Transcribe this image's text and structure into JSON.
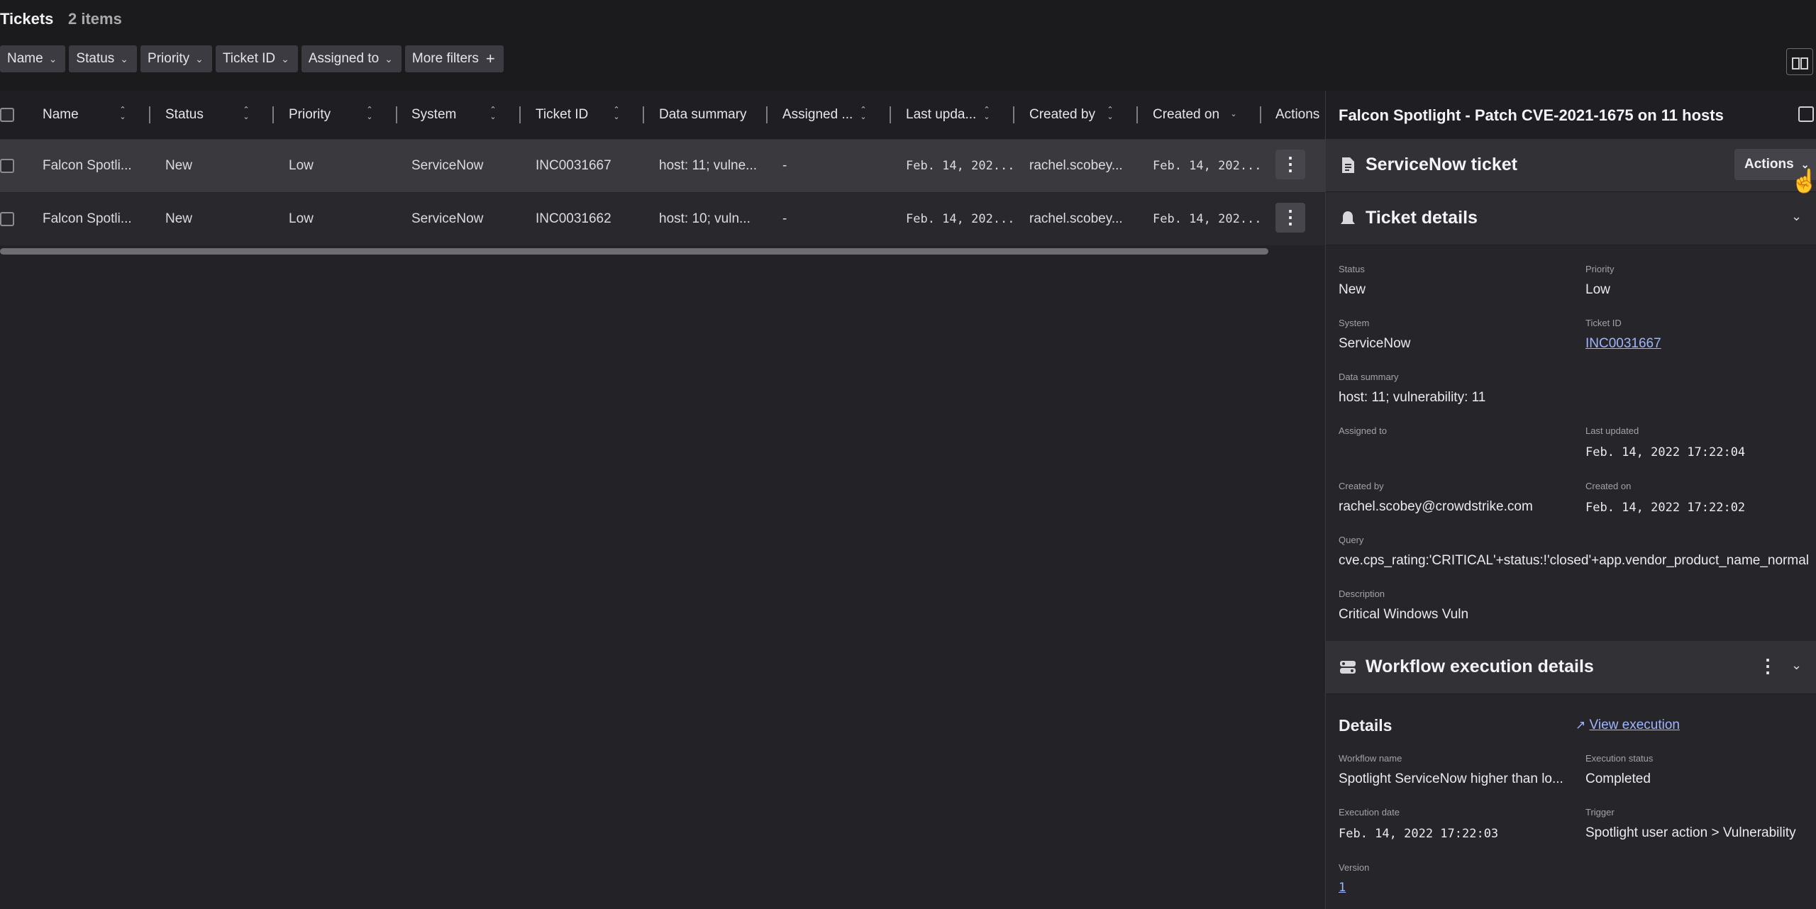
{
  "header": {
    "title": "Tickets",
    "count": "2 items"
  },
  "filters": [
    "Name",
    "Status",
    "Priority",
    "Ticket ID",
    "Assigned to",
    "More filters"
  ],
  "table": {
    "columns": [
      "Name",
      "Status",
      "Priority",
      "System",
      "Ticket ID",
      "Data summary",
      "Assigned ...",
      "Last upda...",
      "Created by",
      "Created on",
      "Actions"
    ],
    "rows": [
      {
        "name": "Falcon Spotli...",
        "status": "New",
        "priority": "Low",
        "system": "ServiceNow",
        "ticket_id": "INC0031667",
        "data_summary": "host: 11; vulne...",
        "assigned": "-",
        "last_updated": "Feb. 14, 202...",
        "created_by": "rachel.scobey...",
        "created_on": "Feb. 14, 202..."
      },
      {
        "name": "Falcon Spotli...",
        "status": "New",
        "priority": "Low",
        "system": "ServiceNow",
        "ticket_id": "INC0031662",
        "data_summary": "host: 10; vuln...",
        "assigned": "-",
        "last_updated": "Feb. 14, 202...",
        "created_by": "rachel.scobey...",
        "created_on": "Feb. 14, 202..."
      }
    ]
  },
  "panel": {
    "title": "Falcon Spotlight - Patch CVE-2021-1675 on 11 hosts",
    "ticket_section": "ServiceNow ticket",
    "actions_label": "Actions",
    "details_section": "Ticket details",
    "fields": {
      "status_label": "Status",
      "status": "New",
      "priority_label": "Priority",
      "priority": "Low",
      "system_label": "System",
      "system": "ServiceNow",
      "ticket_id_label": "Ticket ID",
      "ticket_id": "INC0031667",
      "data_summary_label": "Data summary",
      "data_summary": "host: 11; vulnerability: 11",
      "assigned_label": "Assigned to",
      "last_updated_label": "Last updated",
      "last_updated": "Feb. 14, 2022 17:22:04",
      "created_by_label": "Created by",
      "created_by": "rachel.scobey@crowdstrike.com",
      "created_on_label": "Created on",
      "created_on": "Feb. 14, 2022 17:22:02",
      "query_label": "Query",
      "query": "cve.cps_rating:'CRITICAL'+status:!'closed'+app.vendor_product_name_normali...",
      "description_label": "Description",
      "description": "Critical Windows Vuln"
    },
    "workflow_section": "Workflow execution details",
    "workflow": {
      "details_heading": "Details",
      "view_execution": "View execution",
      "workflow_name_label": "Workflow name",
      "workflow_name": "Spotlight ServiceNow higher than lo...",
      "execution_status_label": "Execution status",
      "execution_status": "Completed",
      "execution_date_label": "Execution date",
      "execution_date": "Feb. 14, 2022 17:22:03",
      "trigger_label": "Trigger",
      "trigger": "Spotlight user action > Vulnerability",
      "version_label": "Version",
      "version": "1"
    }
  }
}
